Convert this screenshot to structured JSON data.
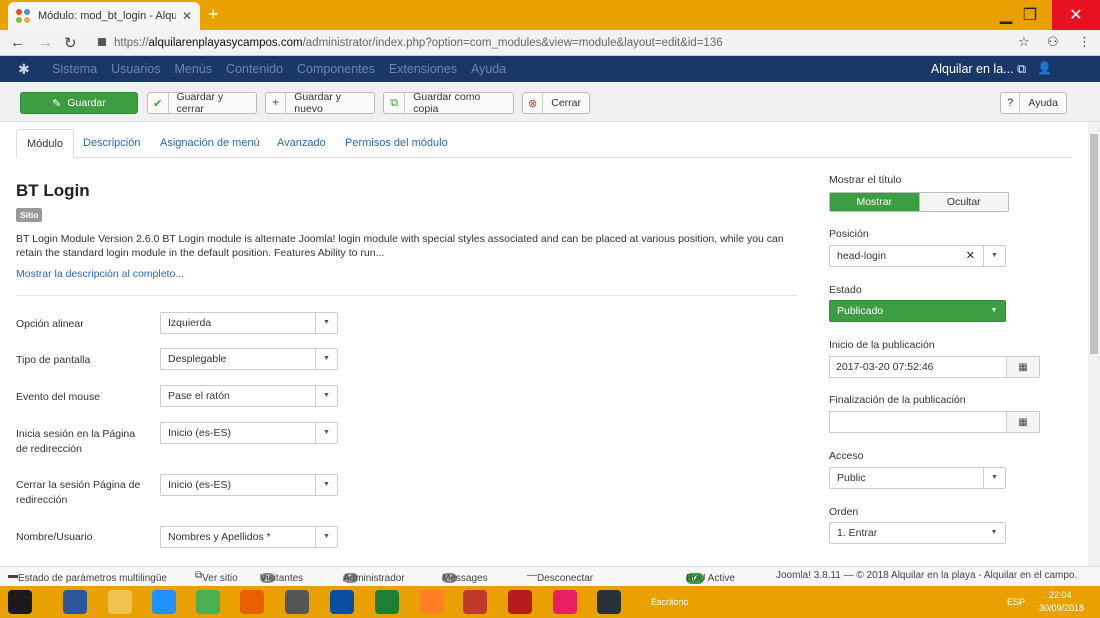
{
  "browser": {
    "tab_title": "Módulo: mod_bt_login - Alquilar",
    "url_scheme": "https://",
    "url_host": "alquilarenplayasycampos.com",
    "url_path": "/administrator/index.php?option=com_modules&view=module&layout=edit&id=136"
  },
  "adminbar": {
    "menu": [
      "Sistema",
      "Usuarios",
      "Menús",
      "Contenido",
      "Componentes",
      "Extensiones",
      "Ayuda"
    ],
    "site_link": "Alquilar en la..."
  },
  "toolbar": {
    "save": "Guardar",
    "save_close": "Guardar y cerrar",
    "save_new": "Guardar y nuevo",
    "save_copy": "Guardar como copia",
    "close": "Cerrar",
    "help": "Ayuda"
  },
  "tabs": [
    "Módulo",
    "Descripción",
    "Asignación de menú",
    "Avanzado",
    "Permisos del módulo"
  ],
  "module": {
    "title": "BT Login",
    "badge": "Sitio",
    "description": "BT Login Module Version 2.6.0 BT Login module is alternate Joomla! login module with special styles associated and can be placed at various position, while you can retain the standard login module in the default position. Features Ability to run...",
    "more_link": "Mostrar la descripción al completo..."
  },
  "fields": [
    {
      "label": "Opción alinear",
      "value": "Izquierda"
    },
    {
      "label": "Tipo de pantalla",
      "value": "Desplegable"
    },
    {
      "label": "Evento del mouse",
      "value": "Pase el ratón"
    },
    {
      "label": "Inicia sesión en la Página de redirección",
      "value": "Inicio (es-ES)"
    },
    {
      "label": "Cerrar la sesión Página de redirección",
      "value": "Inicio (es-ES)"
    },
    {
      "label": "Nombre/Usuario",
      "value": "Nombres y Apellidos *"
    }
  ],
  "sidebar": {
    "show_title_label": "Mostrar el título",
    "show_option": "Mostrar",
    "hide_option": "Ocultar",
    "position_label": "Posición",
    "position_value": "head-login",
    "state_label": "Estado",
    "state_value": "Publicado",
    "publish_up_label": "Inicio de la publicación",
    "publish_up_value": "2017-03-20 07:52:46",
    "publish_down_label": "Finalización de la publicación",
    "publish_down_value": "",
    "access_label": "Acceso",
    "access_value": "Public",
    "order_label": "Orden",
    "order_value": "1. Entrar"
  },
  "statusbar": {
    "multilang": "Estado de parámetros multilingüe",
    "view_site": "Ver sitio",
    "visitors_count": "2",
    "visitors_label": "Visitantes",
    "admin_count": "1",
    "admin_label": "Administrador",
    "messages_count": "0",
    "messages_label": "Messages",
    "logout": "Desconectar",
    "bou_label": "BoU Active",
    "version": "Joomla! 3.8.11 — © 2018 Alquilar en la playa - Alquilar en el campo."
  },
  "taskbar": {
    "desktop": "Escritorio",
    "lang": "ESP",
    "time": "22:04",
    "date": "30/09/2018"
  },
  "colors": {
    "accent_orange": "#e8a100",
    "admin_navy": "#1a3867",
    "success_green": "#3c9d42",
    "link_blue": "#2a69b8"
  }
}
